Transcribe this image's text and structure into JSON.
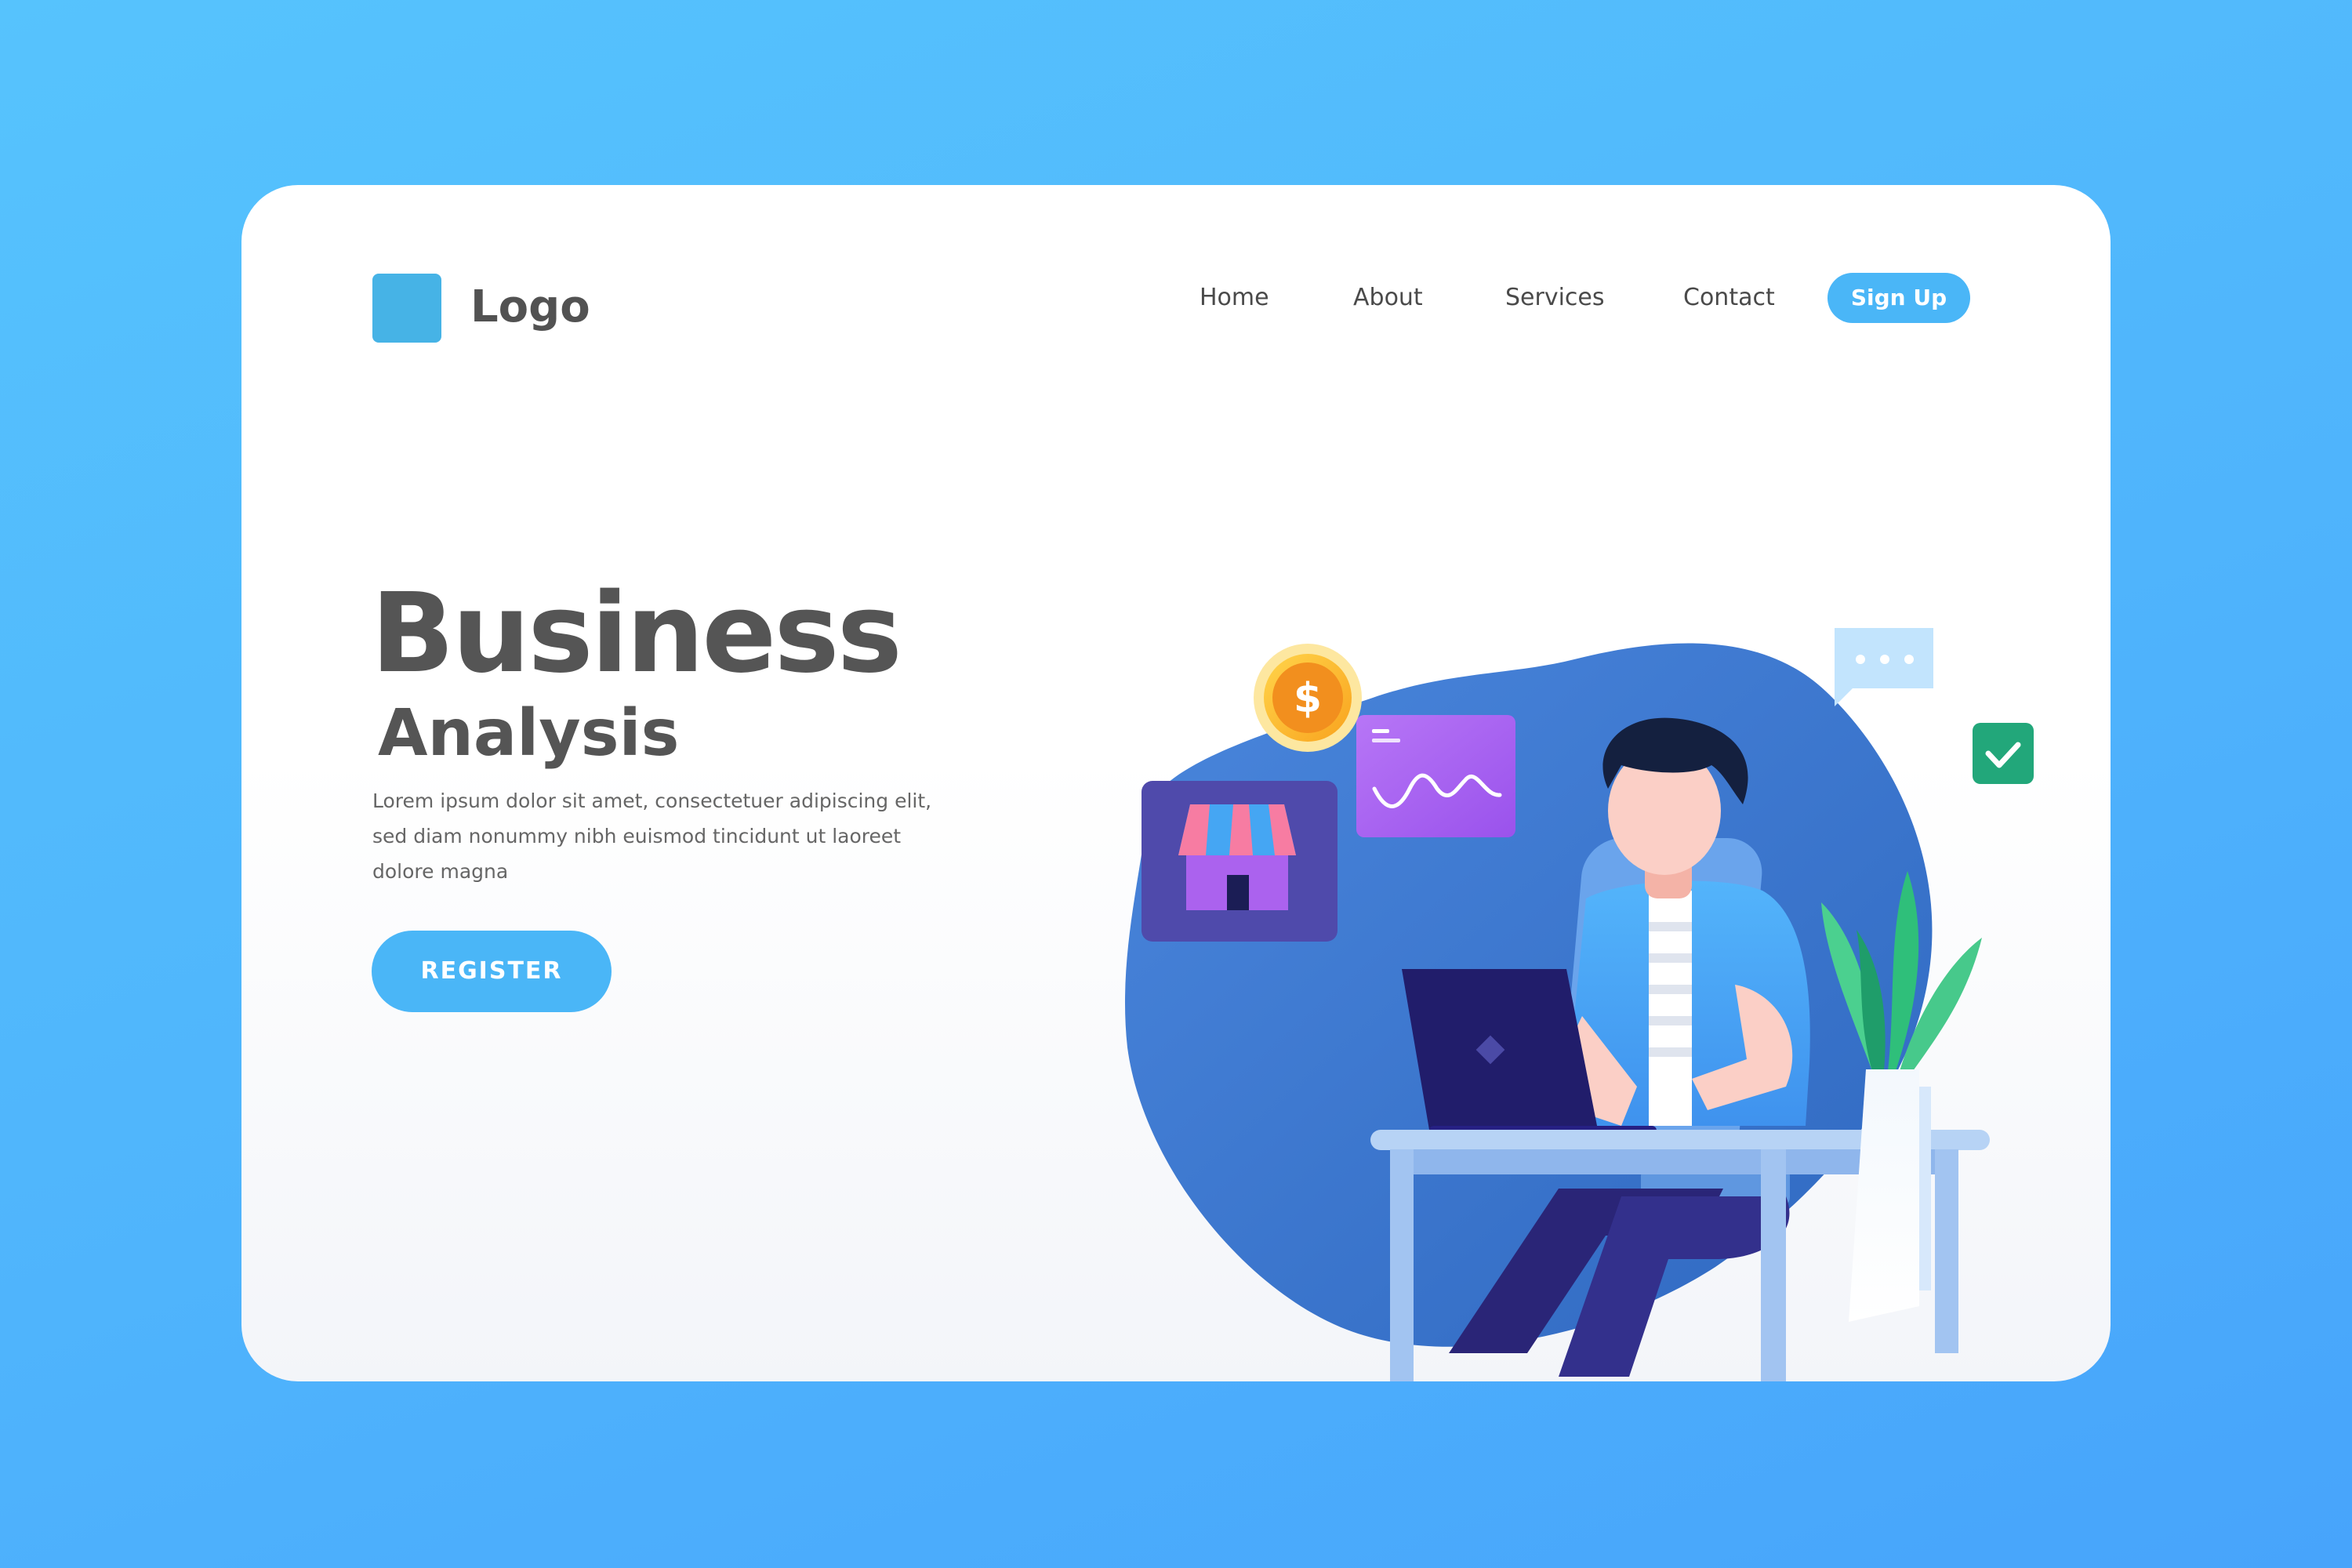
{
  "header": {
    "logo_text": "Logo",
    "nav": [
      {
        "label": "Home"
      },
      {
        "label": "About"
      },
      {
        "label": "Services"
      },
      {
        "label": "Contact"
      }
    ],
    "signup_label": "Sign Up"
  },
  "hero": {
    "title": "Business",
    "subtitle": "Analysis",
    "description": "Lorem ipsum dolor sit amet, consectetuer adipiscing elit, sed diam nonummy nibh euismod tincidunt ut laoreet dolore magna",
    "register_label": "REGISTER"
  },
  "illustration": {
    "coin_symbol": "$",
    "icons": [
      "dollar-coin-icon",
      "chat-bubble-icon",
      "checkmark-icon",
      "store-icon",
      "wave-chart-icon",
      "laptop-icon",
      "plant-icon"
    ]
  },
  "colors": {
    "accent": "#4ab6f7",
    "logo": "#46b3e6",
    "heading": "#555555",
    "blob": "#3b78d0",
    "store_panel": "#4f4aab",
    "chart_panel": "#a45df0",
    "check": "#22a77a",
    "coin": "#fbb02c"
  }
}
